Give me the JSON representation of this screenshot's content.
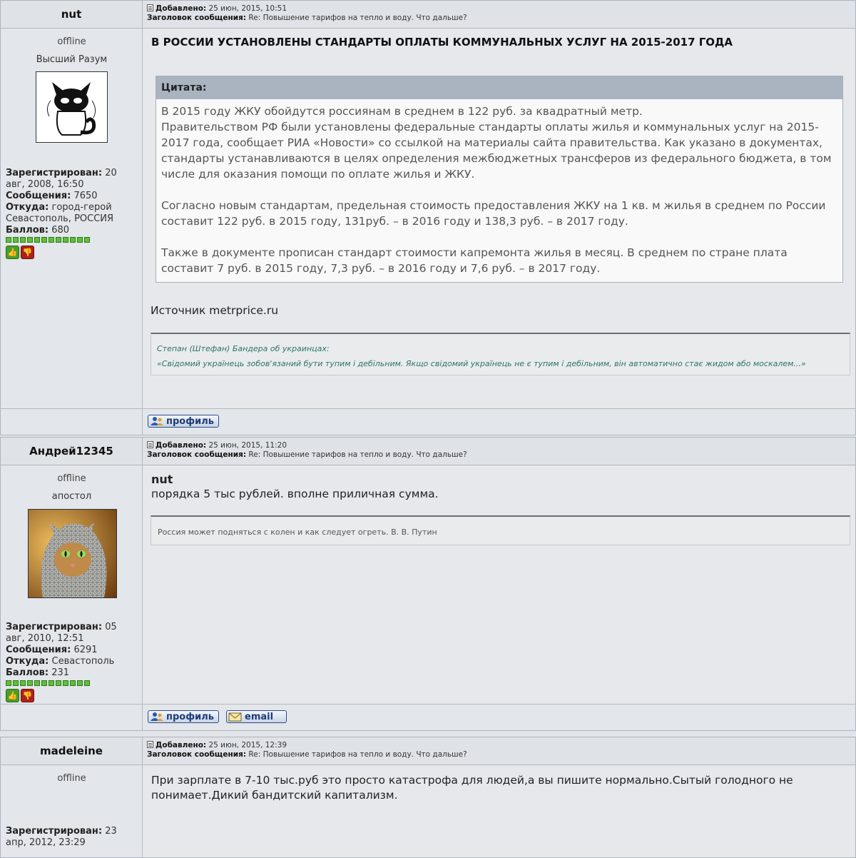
{
  "labels": {
    "added": "Добавлено:",
    "subject": "Заголовок сообщения:",
    "registered": "Зарегистрирован:",
    "posts": "Сообщения:",
    "from": "Откуда:",
    "points": "Баллов:",
    "quote": "Цитата:",
    "profile_btn": "профиль",
    "email_btn": "email"
  },
  "posts": [
    {
      "username": "nut",
      "date": "25 июн, 2015, 10:51",
      "subject": "Re: Повышение тарифов на тепло и воду. Что дальше?",
      "status": "offline",
      "rank": "Высший Разум",
      "registered": "20 авг, 2008, 16:50",
      "posts": "7650",
      "from": "город-герой Севастополь, РОССИЯ",
      "points": "680",
      "title": "В РОССИИ УСТАНОВЛЕНЫ СТАНДАРТЫ ОПЛАТЫ КОММУНАЛЬНЫХ УСЛУГ НА 2015-2017 ГОДА",
      "quote_p1": "В 2015 году ЖКУ обойдутся россиянам в среднем в 122 руб. за квадратный метр.",
      "quote_p2": "Правительством РФ были установлены федеральные стандарты оплаты жилья и коммунальных услуг на 2015-2017 года, сообщает РИА «Новости» со ссылкой на материалы сайта правительства. Как указано в документах, стандарты устанавливаются в целях определения межбюджетных трансферов из федерального бюджета, в том числе для оказания помощи по оплате жилья и ЖКУ.",
      "quote_p3": "Согласно новым стандартам, предельная стоимость предоставления ЖКУ на 1 кв. м жилья в среднем по России составит 122 руб. в 2015 году, 131руб. – в 2016 году и 138,3 руб. – в 2017 году.",
      "quote_p4": "Также в документе прописан стандарт стоимости капремонта жилья в месяц. В среднем по стране плата составит 7 руб. в 2015 году, 7,3 руб. – в 2016 году и 7,6 руб. – в 2017 году.",
      "source": "Источник metrprice.ru",
      "sig1": "Степан (Штефан) Бандера об украинцах:",
      "sig2": "«Свідомий українець зобов'язаний бути тупим і дебільним. Якщо свідомий українець не є тупим і дебільним, він автоматично стає жидом або москалем...»"
    },
    {
      "username": "Андрей12345",
      "date": "25 июн, 2015, 11:20",
      "subject": "Re: Повышение тарифов на тепло и воду. Что дальше?",
      "status": "offline",
      "rank": "апостол",
      "registered": "05 авг, 2010, 12:51",
      "posts": "6291",
      "from": "Севастополь",
      "points": "231",
      "reply_to": "nut",
      "message": "порядка 5 тыс рублей. вполне приличная сумма.",
      "sig": "Россия может подняться с колен и как следует огреть. В. В. Путин"
    },
    {
      "username": "madeleine",
      "date": "25 июн, 2015, 12:39",
      "subject": "Re: Повышение тарифов на тепло и воду. Что дальше?",
      "status": "offline",
      "registered": "23 апр, 2012, 23:29",
      "message": "При зарплате в 7-10 тыс.руб это просто катастрофа для людей,а вы пишите нормально.Сытый голодного не понимает.Дикий бандитский капитализм."
    }
  ]
}
